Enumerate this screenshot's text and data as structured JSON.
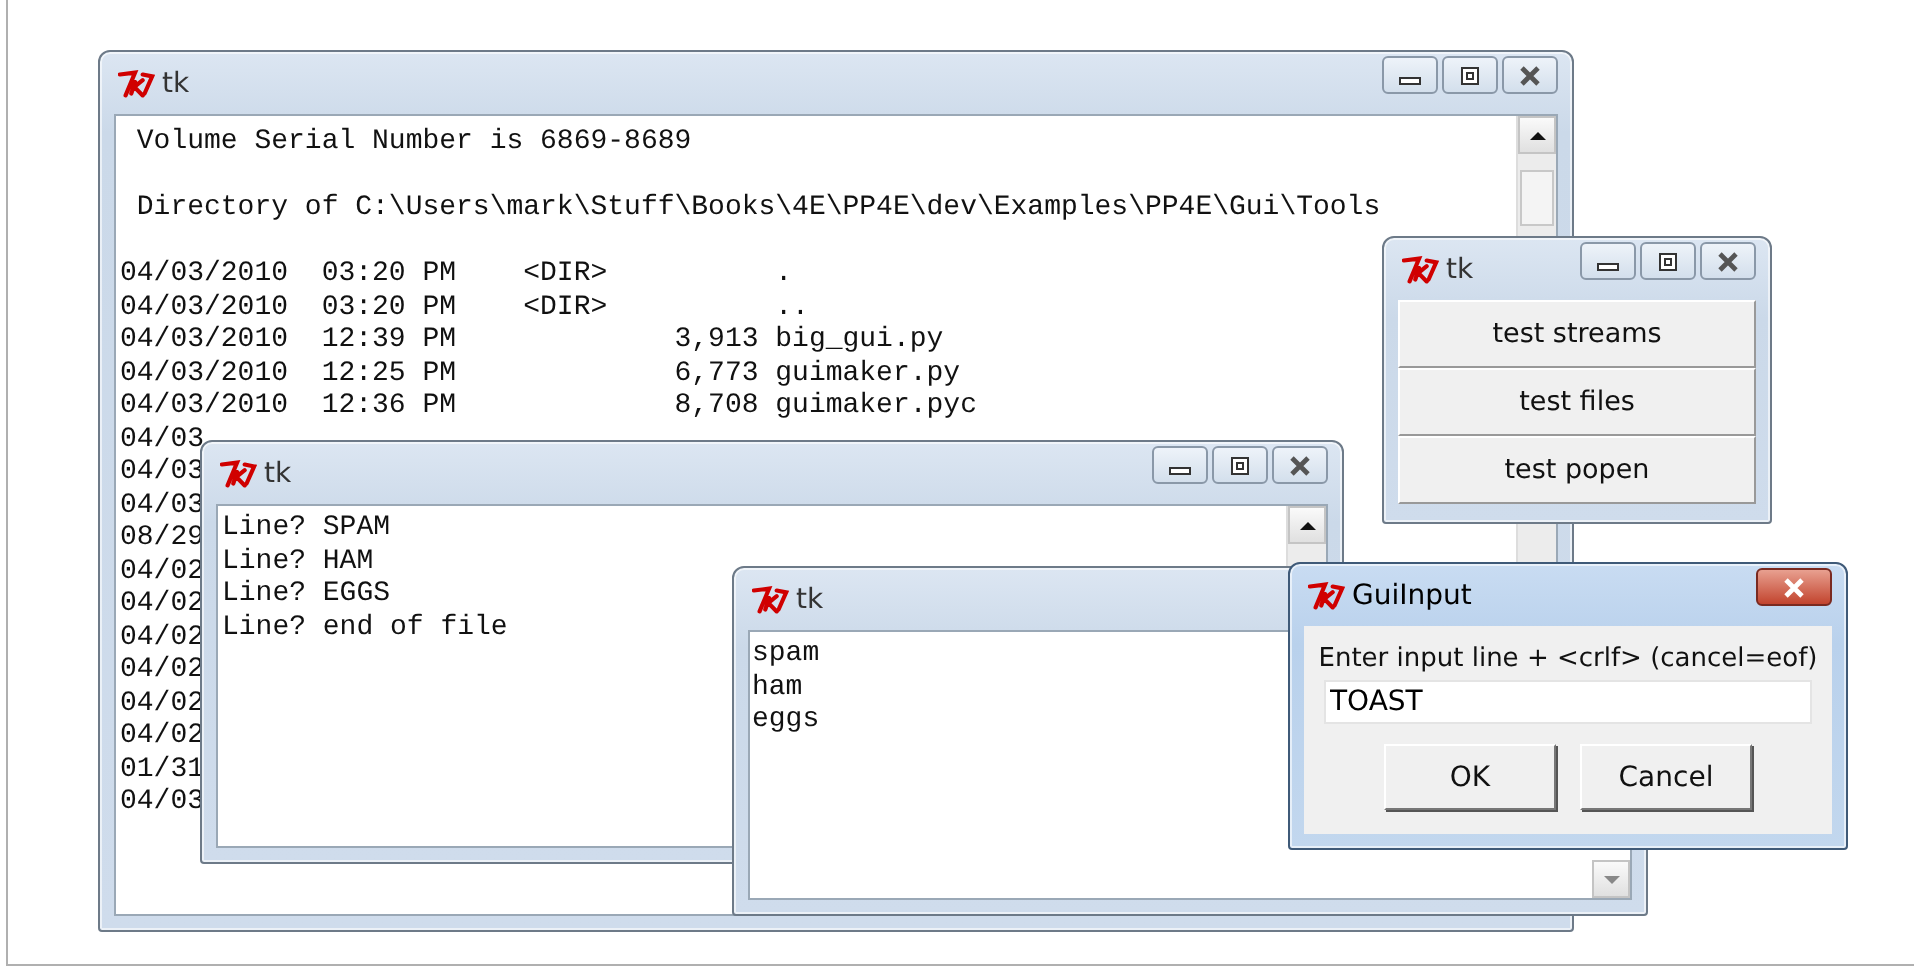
{
  "windows": [
    {
      "kind": "text",
      "title": "tk",
      "active": false,
      "header": [
        " Volume Serial Number is 6869-8689",
        " Directory of C:\\Users\\mark\\Stuff\\Books\\4E\\PP4E\\dev\\Examples\\PP4E\\Gui\\Tools"
      ],
      "lines": [
        "04/03/2010  03:20 PM    <DIR>          .",
        "04/03/2010  03:20 PM    <DIR>          ..",
        "04/03/2010  12:39 PM             3,913 big_gui.py",
        "04/03/2010  12:25 PM             6,773 guimaker.py",
        "04/03/2010  12:36 PM             8,708 guimaker.pyc",
        "04/03",
        "04/03",
        "04/03",
        "08/29",
        "04/02",
        "04/02",
        "04/02",
        "04/02",
        "04/02",
        "04/02",
        "01/31",
        "04/03"
      ]
    },
    {
      "kind": "buttons",
      "title": "tk",
      "active": false,
      "buttons": [
        "test streams",
        "test files",
        "test popen"
      ]
    },
    {
      "kind": "text",
      "title": "tk",
      "active": false,
      "lines": [
        "Line? SPAM",
        "Line? HAM",
        "Line? EGGS",
        "Line? end of file"
      ]
    },
    {
      "kind": "text",
      "title": "tk",
      "active": false,
      "lines": [
        "spam",
        "ham",
        "eggs"
      ]
    },
    {
      "kind": "dialog",
      "title": "GuiInput",
      "active": true,
      "prompt": "Enter input line + <crlf> (cancel=eof)",
      "value": "TOAST",
      "buttons": [
        "OK",
        "Cancel"
      ]
    }
  ]
}
